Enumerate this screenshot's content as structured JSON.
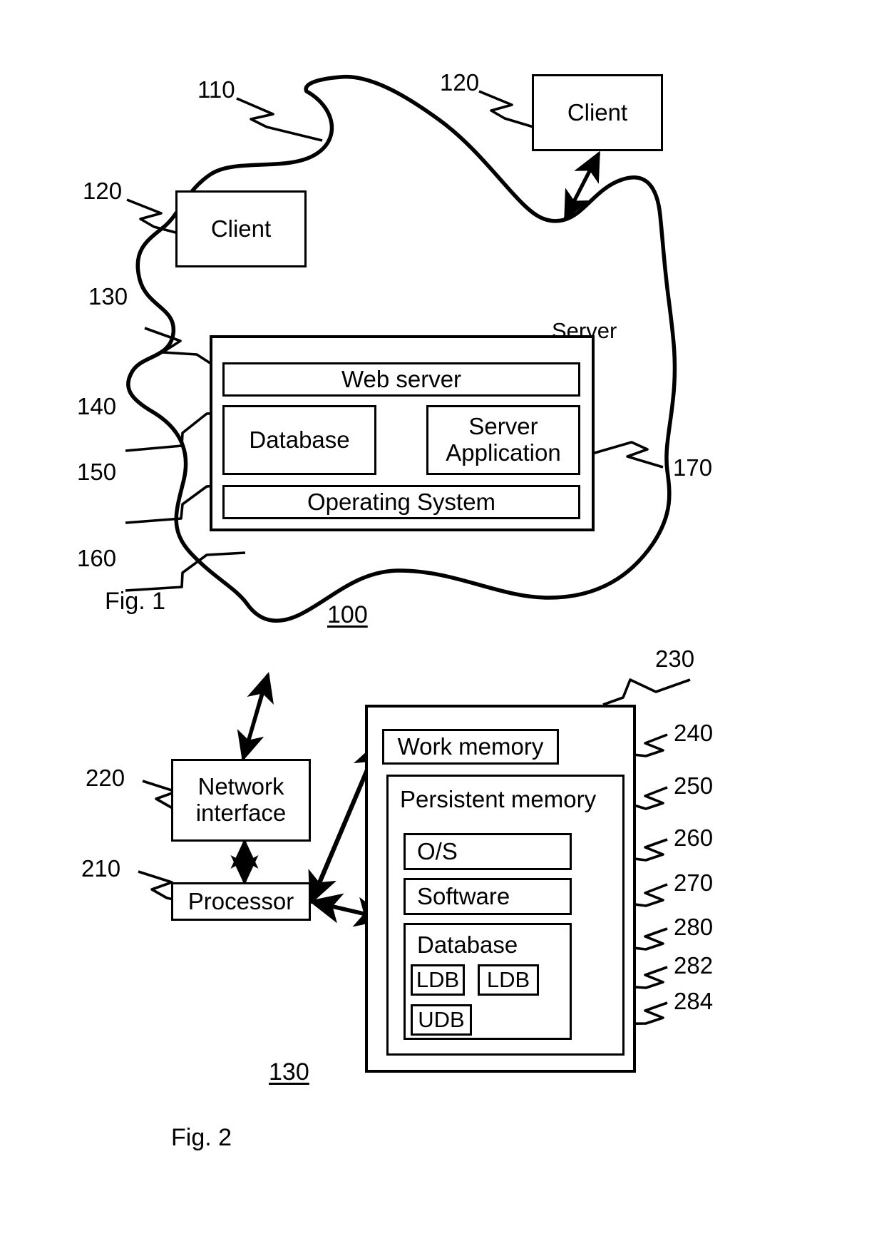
{
  "figure1": {
    "fig_label": "Fig. 1",
    "caption": "100",
    "cloud_ref": "110",
    "server_label": "Server",
    "clients": [
      {
        "text": "Client",
        "ref": "120"
      },
      {
        "text": "Client",
        "ref": "120"
      }
    ],
    "server_ref": "130",
    "blocks": [
      {
        "text": "Web server",
        "ref": "140"
      },
      {
        "text": "Database",
        "ref": "150"
      },
      {
        "text": "Server Application",
        "line1": "Server",
        "line2": "Application",
        "ref": "170"
      },
      {
        "text": "Operating System",
        "ref": "160"
      }
    ],
    "refs": {
      "network": "110",
      "client_left": "120",
      "client_right": "120",
      "server": "130",
      "web_server": "140",
      "database": "150",
      "operating_system": "160",
      "server_application": "170"
    }
  },
  "figure2": {
    "fig_label": "Fig. 2",
    "caption": "130",
    "blocks": {
      "network_interface": {
        "line1": "Network",
        "line2": "interface",
        "ref": "220"
      },
      "processor": {
        "text": "Processor",
        "ref": "210"
      },
      "memory_unit": {
        "ref": "230"
      },
      "work_memory": {
        "text": "Work memory",
        "ref": "240"
      },
      "persistent_memory": {
        "text": "Persistent memory",
        "ref": "250"
      },
      "os": {
        "text": "O/S",
        "ref": "260"
      },
      "software": {
        "text": "Software",
        "ref": "270"
      },
      "database": {
        "text": "Database",
        "ref": "280"
      },
      "ldb1": {
        "text": "LDB",
        "ref": "282"
      },
      "ldb2": {
        "text": "LDB",
        "ref": "282"
      },
      "udb": {
        "text": "UDB",
        "ref": "284"
      }
    },
    "refs": {
      "processor": "210",
      "network_interface": "220",
      "memory": "230",
      "work_memory": "240",
      "persistent_memory": "250",
      "os": "260",
      "software": "270",
      "database": "280",
      "ldb": "282",
      "udb": "284"
    }
  },
  "style": {
    "ink": "#000000",
    "paper": "#ffffff"
  }
}
